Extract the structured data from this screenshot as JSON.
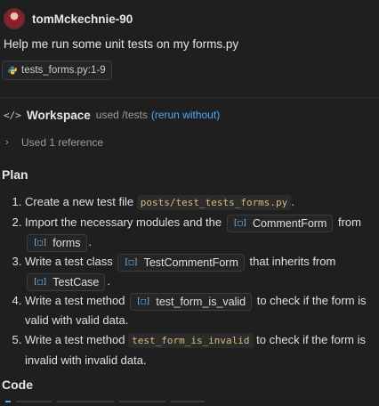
{
  "user": {
    "name": "tomMckechnie-90"
  },
  "prompt": "Help me run some unit tests on my forms.py",
  "reference_chip": "tests_forms.py:1-9",
  "workspace": {
    "name": "Workspace",
    "used": "used /tests",
    "rerun_link": "(rerun without)"
  },
  "used_reference": "Used 1 reference",
  "sections": {
    "plan": "Plan",
    "code": "Code"
  },
  "plan": {
    "step1": {
      "a": "Create a new test file ",
      "code": "posts/test_tests_forms.py",
      "b": "."
    },
    "step2": {
      "a": "Import the necessary modules and the ",
      "sym1": "CommentForm",
      "b": " from ",
      "sym2": "forms",
      "c": "."
    },
    "step3": {
      "a": "Write a test class ",
      "sym1": "TestCommentForm",
      "b": " that inherits from ",
      "sym2": "TestCase",
      "c": "."
    },
    "step4": {
      "a": "Write a test method ",
      "sym1": "test_form_is_valid",
      "b": " to check if the form is valid with valid data."
    },
    "step5": {
      "a": "Write a test method ",
      "code": "test_form_is_invalid",
      "b": " to check if the form is invalid with invalid data."
    }
  },
  "colors": {
    "background": "#1f1f1f",
    "link": "#4daafc",
    "inline_code": "#d7ba7d",
    "symbol_icon": "#75beff"
  },
  "icons": {
    "reference": "python-file-icon",
    "workspace": "code-brackets-icon",
    "expand": "chevron-right-icon",
    "symbol": "symbol-class-icon"
  }
}
